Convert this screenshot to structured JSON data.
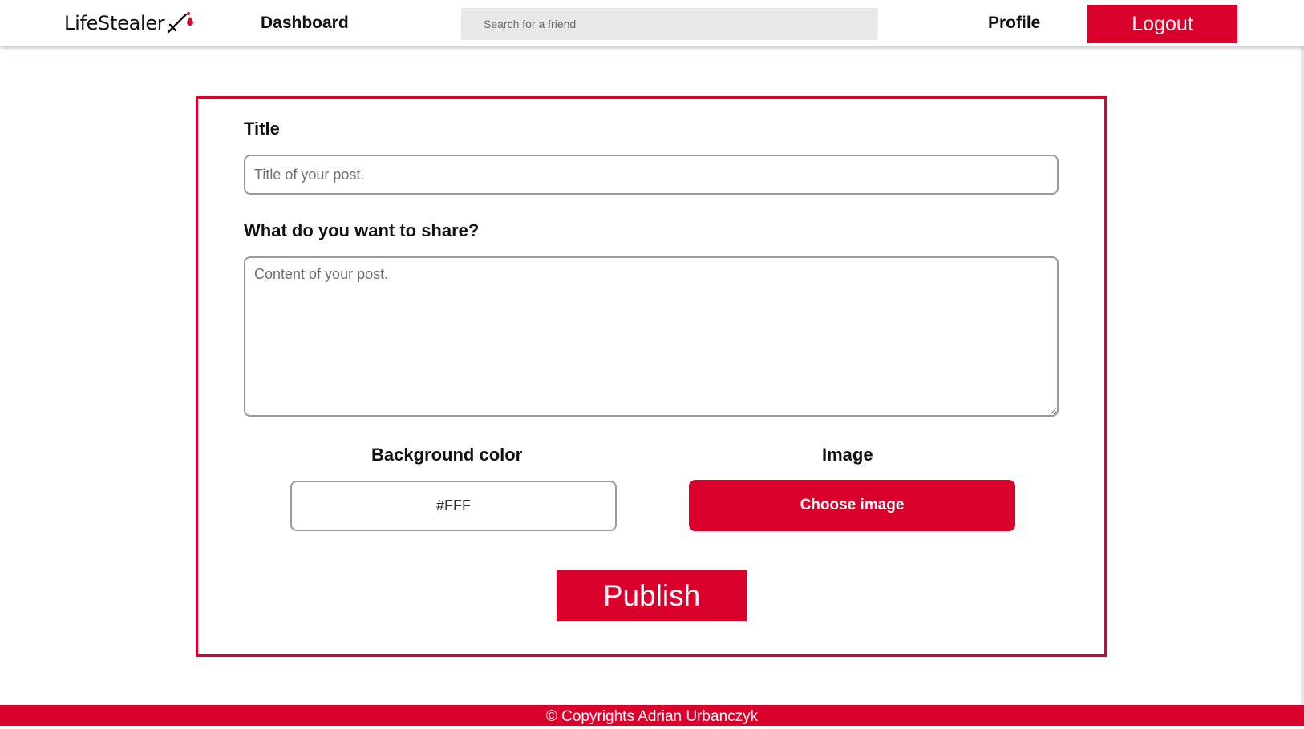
{
  "navbar": {
    "logo_text": "LifeStealer",
    "logo_icon": "sword-blood-icon",
    "dashboard_label": "Dashboard",
    "search_placeholder": "Search for a friend",
    "profile_label": "Profile",
    "logout_label": "Logout"
  },
  "form": {
    "title_label": "Title",
    "title_placeholder": "Title of your post.",
    "content_label": "What do you want to share?",
    "content_placeholder": "Content of your post.",
    "background_label": "Background color",
    "background_value": "#FFF",
    "image_label": "Image",
    "choose_image_label": "Choose image",
    "publish_label": "Publish"
  },
  "footer": {
    "copyright": "© Copyrights Adrian Urbanczyk"
  },
  "colors": {
    "accent": "#d9002b",
    "search_bg": "#e8e8e8",
    "border_gray": "#9a9a9a"
  }
}
